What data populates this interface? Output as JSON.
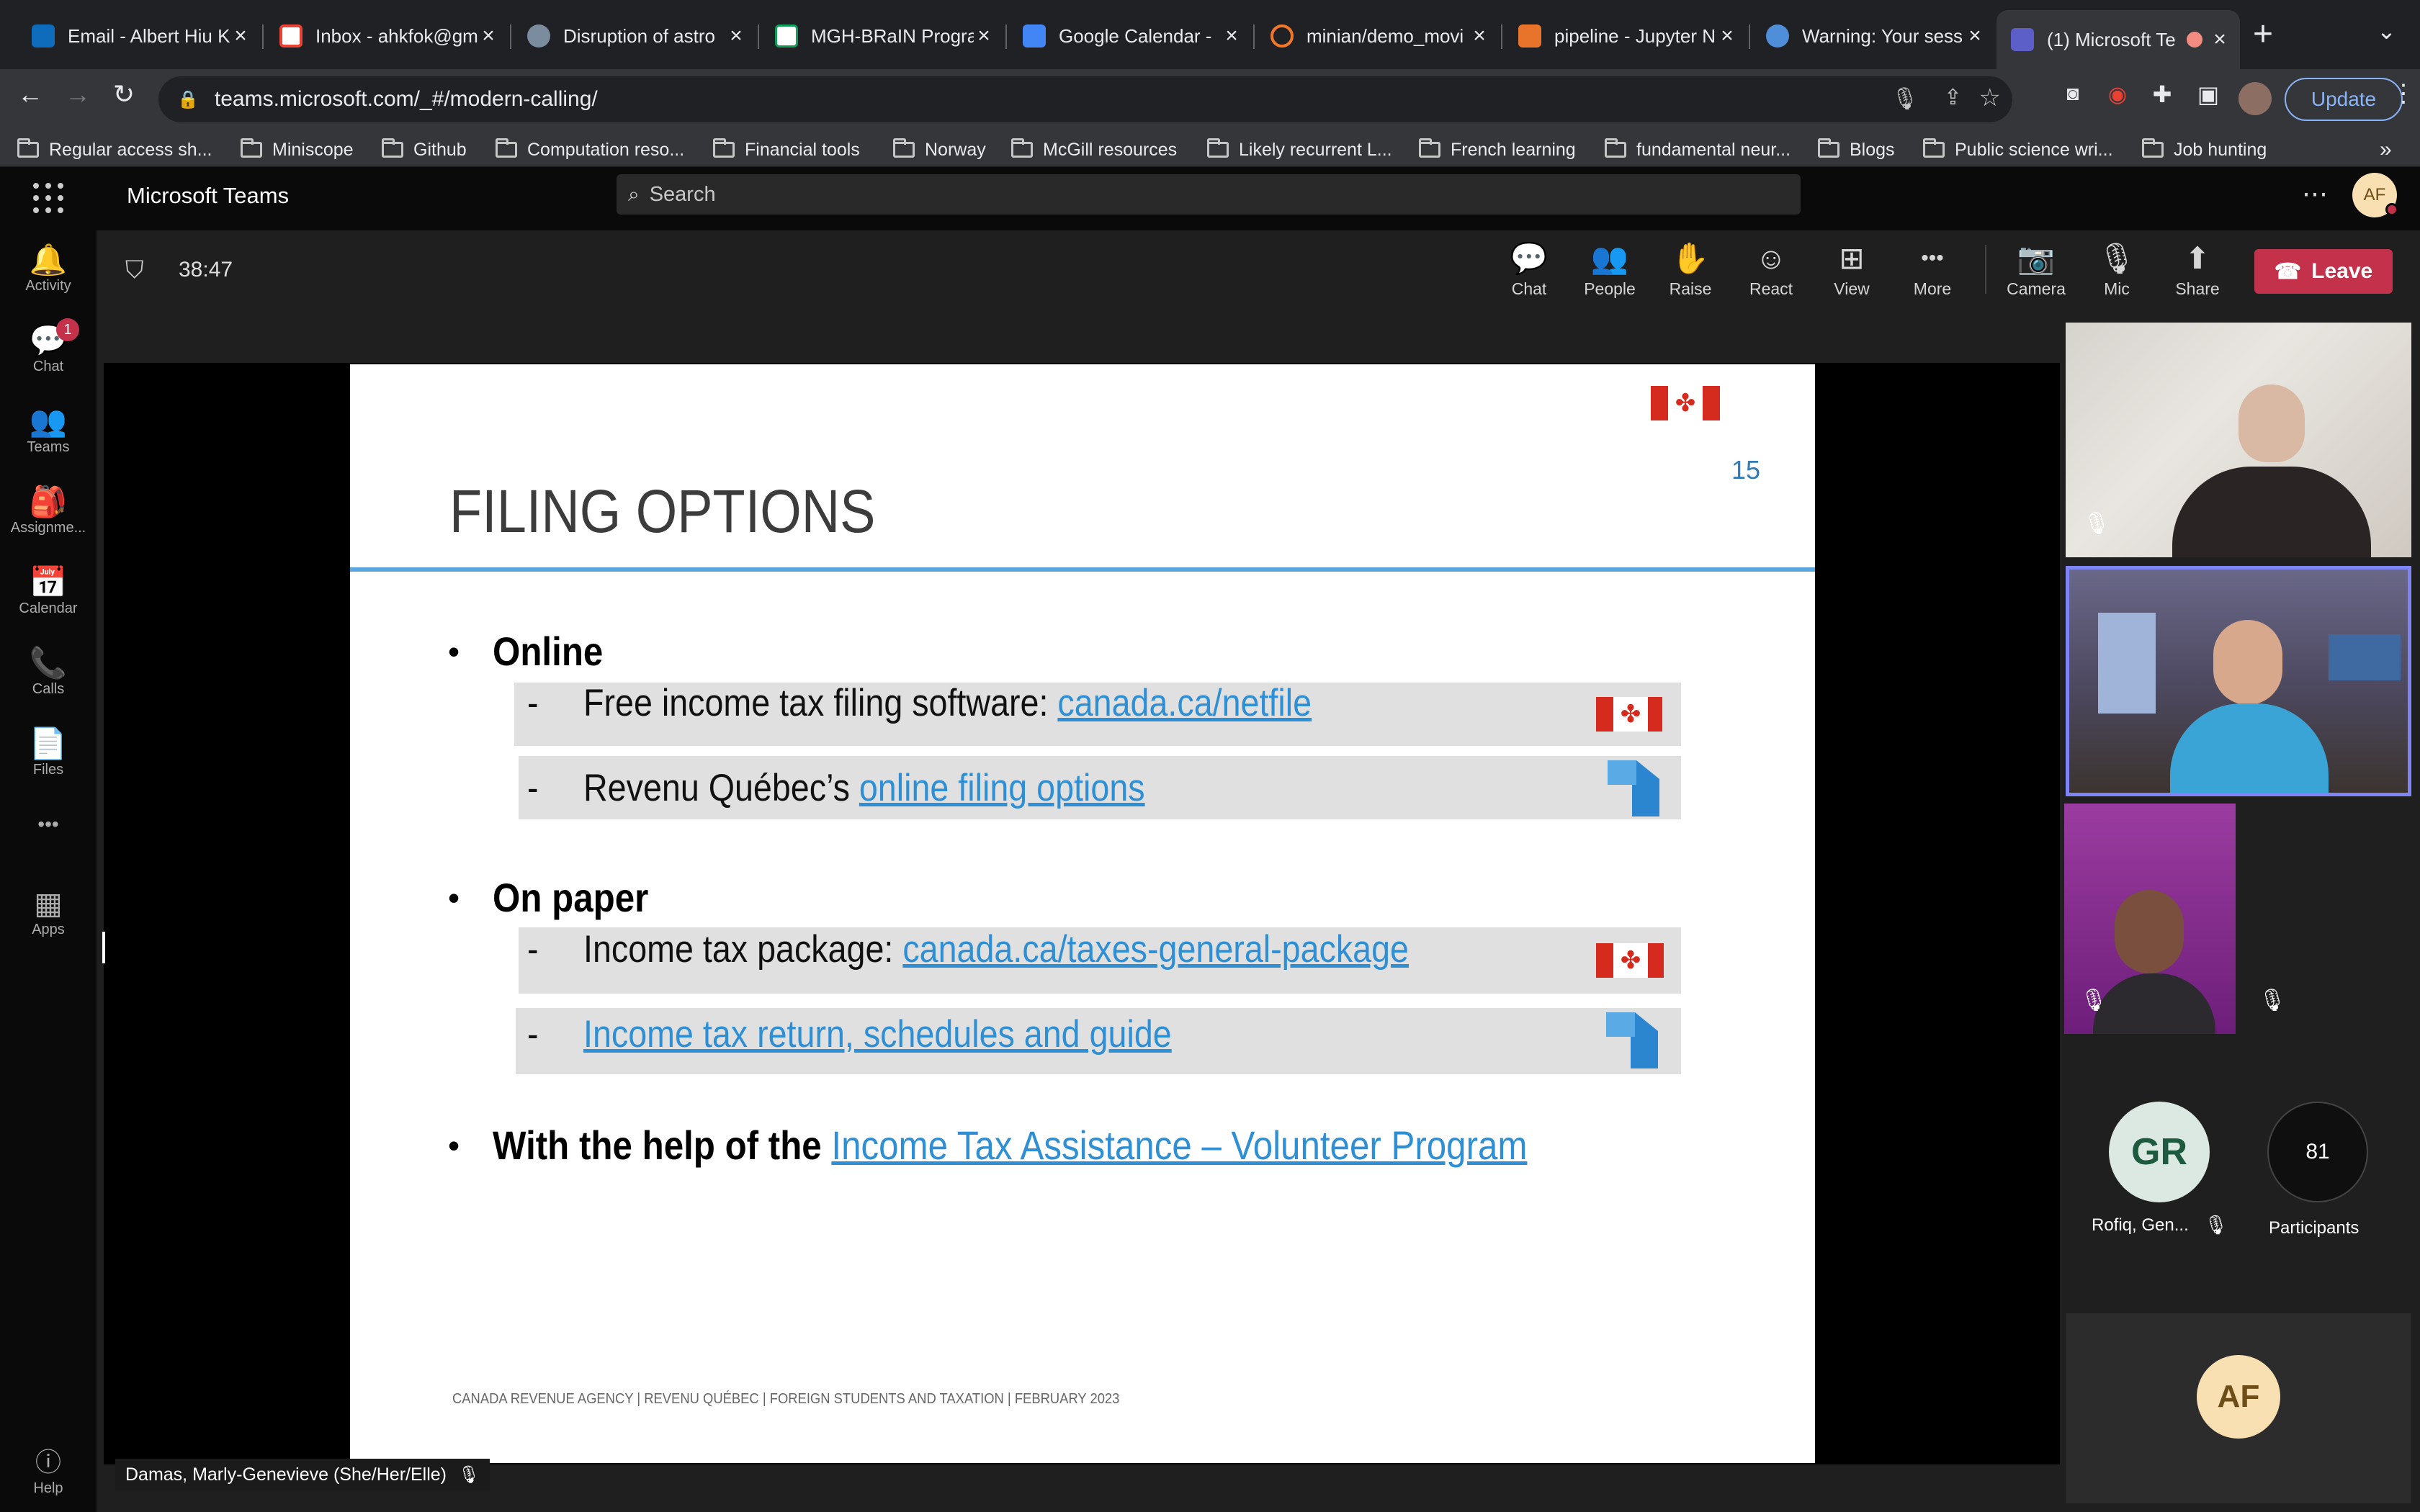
{
  "browser": {
    "tabs": [
      {
        "title": "Email - Albert Hiu K",
        "icon": "outlook-icon",
        "color": "#0f6cbd"
      },
      {
        "title": "Inbox - ahkfok@gm",
        "icon": "gmail-icon",
        "color": "#ea4335"
      },
      {
        "title": "Disruption of astro",
        "icon": "biorxiv-icon",
        "color": "#7a8c9e"
      },
      {
        "title": "MGH-BRaIN Progra",
        "icon": "sheets-icon",
        "color": "#ffffff"
      },
      {
        "title": "Google Calendar -",
        "icon": "calendar-icon",
        "color": "#4285f4"
      },
      {
        "title": "minian/demo_movi",
        "icon": "jupyter-icon",
        "color": "#f37726"
      },
      {
        "title": "pipeline - Jupyter N",
        "icon": "jupyter-book-icon",
        "color": "#e8742b"
      },
      {
        "title": "Warning: Your sess",
        "icon": "globe-icon",
        "color": "#4f8ed8"
      },
      {
        "title": "(1) Microsoft Te",
        "icon": "teams-icon",
        "color": "#5b5fc7"
      }
    ],
    "url": "teams.microsoft.com/_#/modern-calling/",
    "update_label": "Update",
    "bookmarks": [
      "Regular access sh...",
      "Miniscope",
      "Github",
      "Computation reso...",
      "Financial tools",
      "Norway",
      "McGill resources",
      "Likely recurrent L...",
      "French learning",
      "fundamental neur...",
      "Blogs",
      "Public science wri...",
      "Job hunting"
    ],
    "bookmarks_overflow": "»"
  },
  "teams": {
    "app_title": "Microsoft Teams",
    "search_placeholder": "Search",
    "user_initials": "AF",
    "rail": [
      {
        "label": "Activity",
        "icon": "bell-icon",
        "glyph": "🔔"
      },
      {
        "label": "Chat",
        "icon": "chat-icon",
        "glyph": "💬",
        "badge": "1"
      },
      {
        "label": "Teams",
        "icon": "teams-people-icon",
        "glyph": "👥"
      },
      {
        "label": "Assignme...",
        "icon": "assignments-icon",
        "glyph": "🎒"
      },
      {
        "label": "Calendar",
        "icon": "calendar-rail-icon",
        "glyph": "📅"
      },
      {
        "label": "Calls",
        "icon": "phone-icon",
        "glyph": "📞"
      },
      {
        "label": "Files",
        "icon": "file-icon",
        "glyph": "📄"
      },
      {
        "label": "",
        "icon": "more-dots-icon",
        "glyph": "•••"
      },
      {
        "label": "Apps",
        "icon": "apps-icon",
        "glyph": "▦"
      }
    ],
    "help_label": "Help",
    "meeting": {
      "timer": "38:47",
      "controls": [
        {
          "label": "Chat",
          "icon": "chat-bubble-icon",
          "glyph": "💬"
        },
        {
          "label": "People",
          "icon": "people-icon",
          "glyph": "👥"
        },
        {
          "label": "Raise",
          "icon": "hand-icon",
          "glyph": "✋"
        },
        {
          "label": "React",
          "icon": "smiley-icon",
          "glyph": "☺"
        },
        {
          "label": "View",
          "icon": "grid-view-icon",
          "glyph": "⊞"
        },
        {
          "label": "More",
          "icon": "more-horizontal-icon",
          "glyph": "•••"
        },
        {
          "label": "Camera",
          "icon": "camera-off-icon",
          "glyph": "📷"
        },
        {
          "label": "Mic",
          "icon": "mic-off-icon",
          "glyph": "🎙"
        },
        {
          "label": "Share",
          "icon": "share-screen-icon",
          "glyph": "⬆"
        }
      ],
      "leave_label": "Leave",
      "presenter_label": "Damas, Marly-Genevieve (She/Her/Elle)",
      "participant_gr": {
        "initials": "GR",
        "name": "Rofiq, Gen..."
      },
      "participant_count": {
        "count": "81",
        "label": "Participants"
      },
      "self_initials": "AF"
    }
  },
  "slide": {
    "title": "FILING OPTIONS",
    "page_number": "15",
    "sections": [
      {
        "heading": "Online"
      },
      {
        "heading": "On paper"
      },
      {
        "heading_prefix": "With the help of the ",
        "heading_link": "Income Tax Assistance – Volunteer Program"
      }
    ],
    "rows": [
      {
        "dash": "-",
        "text": "Free income tax filing software: ",
        "link": "canada.ca/netfile"
      },
      {
        "dash": "-",
        "text": "Revenu Québec’s ",
        "link": "online filing options"
      },
      {
        "dash": "-",
        "text": "Income tax package: ",
        "link": "canada.ca/taxes-general-package"
      },
      {
        "dash": "-",
        "text": "",
        "link": "Income tax return, schedules and guide"
      }
    ],
    "footer": "CANADA REVENUE AGENCY  |  REVENU QUÉBEC  |  FOREIGN STUDENTS AND TAXATION  |  FEBRUARY 2023",
    "maple_glyph": "✤"
  }
}
